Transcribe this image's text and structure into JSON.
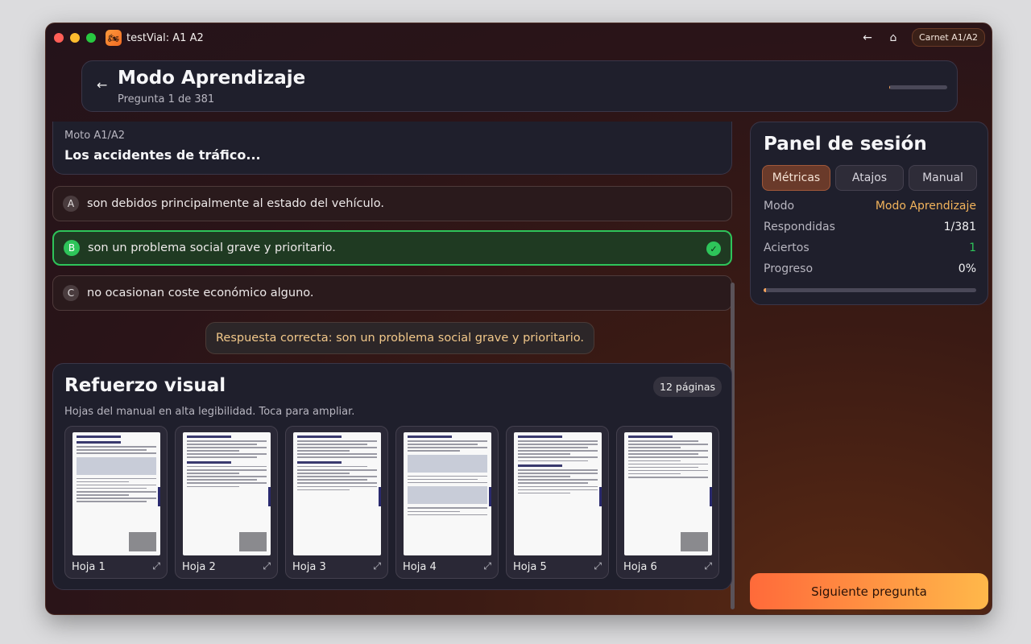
{
  "app": {
    "title": "testVial: A1 A2",
    "carnet_badge": "Carnet A1/A2",
    "icons": {
      "back": "arrow-left-icon",
      "home": "home-icon",
      "app": "motorcycle-icon"
    }
  },
  "header": {
    "title": "Modo Aprendizaje",
    "subtitle": "Pregunta 1 de 381",
    "progress_fraction": 0.0026
  },
  "question": {
    "category": "Moto A1/A2",
    "text": "Los accidentes de tráfico..."
  },
  "options": [
    {
      "letter": "A",
      "text": "son debidos principalmente al estado del vehículo.",
      "correct": false
    },
    {
      "letter": "B",
      "text": "son un problema social grave y prioritario.",
      "correct": true
    },
    {
      "letter": "C",
      "text": "no ocasionan coste económico alguno.",
      "correct": false
    }
  ],
  "feedback": "Respuesta correcta: son un problema social grave y prioritario.",
  "visual": {
    "title": "Refuerzo visual",
    "subtitle": "Hojas del manual en alta legibilidad. Toca para ampliar.",
    "pages_badge": "12 páginas",
    "sheets": [
      "Hoja 1",
      "Hoja 2",
      "Hoja 3",
      "Hoja 4",
      "Hoja 5",
      "Hoja 6"
    ]
  },
  "panel": {
    "title": "Panel de sesión",
    "tabs": [
      "Métricas",
      "Atajos",
      "Manual"
    ],
    "active_tab": "Métricas",
    "metrics": {
      "modo_label": "Modo",
      "modo_value": "Modo Aprendizaje",
      "respondidas_label": "Respondidas",
      "respondidas_value": "1/381",
      "aciertos_label": "Aciertos",
      "aciertos_value": "1",
      "progreso_label": "Progreso",
      "progreso_value": "0%"
    },
    "progress_fraction": 0.0026
  },
  "next_button": "Siguiente pregunta",
  "colors": {
    "accent": "#f3a35c",
    "correct": "#2ec45a",
    "feedback_text": "#f2c88a"
  }
}
